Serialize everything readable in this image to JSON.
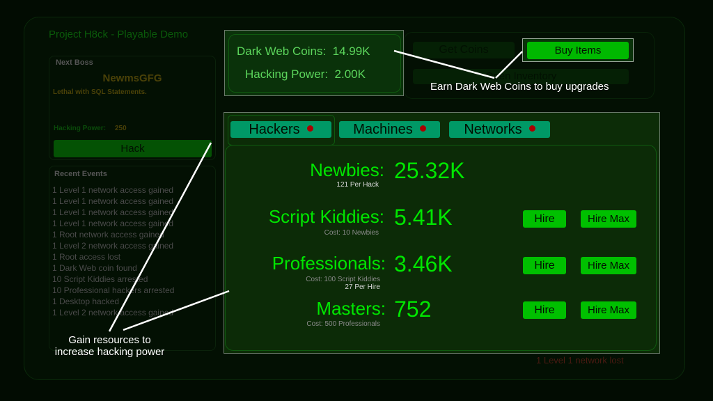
{
  "game_title": "Project H8ck - Playable Demo",
  "boss": {
    "label": "Next Boss",
    "name": "NewmsGFG",
    "description": "Lethal with SQL Statements.",
    "hacking_power_label": "Hacking Power:",
    "hacking_power_value": "250",
    "hack_button": "Hack"
  },
  "events": {
    "label": "Recent Events",
    "items": [
      "1 Level 1 network access gained",
      "1 Level 1 network access gained",
      "1 Level 1 network access gained",
      "1 Level 1 network access gained",
      "1 Root network access gained",
      "1 Level 2 network access gained",
      "1 Root access lost",
      "1 Dark Web coin found",
      "10 Script Kiddies arrested",
      "10 Professional hackers arrested",
      "1 Desktop hacked",
      "1 Level 2 network access gained"
    ],
    "latest_loss": "1 Level 1 network lost"
  },
  "resources": {
    "coins_label": "Dark Web Coins:",
    "coins_value": "14.99K",
    "power_label": "Hacking Power:",
    "power_value": "2.00K"
  },
  "shop": {
    "get_coins": "Get Coins",
    "buy_items": "Buy Items",
    "open_inventory": "Open Inventory"
  },
  "tabs": [
    {
      "label": "Hackers",
      "alert": true,
      "selected": true
    },
    {
      "label": "Machines",
      "alert": true,
      "selected": false
    },
    {
      "label": "Networks",
      "alert": true,
      "selected": false
    }
  ],
  "hackers": [
    {
      "name": "Newbies:",
      "count": "25.32K",
      "sub1": "121 Per Hack",
      "sub2": null
    },
    {
      "name": "Script Kiddies:",
      "count": "5.41K",
      "sub1": "Cost: 10 Newbies",
      "sub2": null,
      "hire": "Hire",
      "hire_max": "Hire Max"
    },
    {
      "name": "Professionals:",
      "count": "3.46K",
      "sub1": "Cost: 100 Script Kiddies",
      "sub2": "27 Per Hire",
      "hire": "Hire",
      "hire_max": "Hire Max"
    },
    {
      "name": "Masters:",
      "count": "752",
      "sub1": "Cost: 500 Professionals",
      "sub2": null,
      "hire": "Hire",
      "hire_max": "Hire Max"
    }
  ],
  "callouts": {
    "coins": "Earn Dark Web Coins to buy upgrades",
    "resources_line1": "Gain resources to",
    "resources_line2": "increase hacking power"
  },
  "colors": {
    "accent_green": "#00e600",
    "button_green": "#00c000",
    "tab_teal": "#009966",
    "alert_red": "#aa0000",
    "boss_gold": "#4a4108"
  }
}
